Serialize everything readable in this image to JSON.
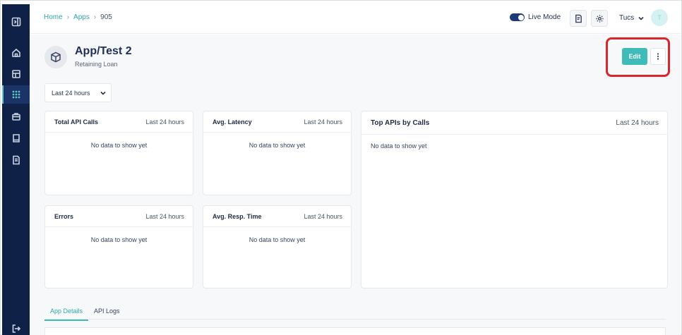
{
  "breadcrumb": {
    "home": "Home",
    "apps": "Apps",
    "current": "905"
  },
  "header": {
    "live_mode_label": "Live Mode",
    "user_name": "Tucs",
    "avatar_initial": "T"
  },
  "app": {
    "title": "App/Test 2",
    "subtitle": "Retaining Loan"
  },
  "actions": {
    "edit_label": "Edit"
  },
  "filter": {
    "time_range": "Last 24 hours"
  },
  "cards": [
    {
      "title": "Total API Calls",
      "range": "Last 24 hours",
      "empty": "No data to show yet"
    },
    {
      "title": "Avg. Latency",
      "range": "Last 24 hours",
      "empty": "No data to show yet"
    },
    {
      "title": "Errors",
      "range": "Last 24 hours",
      "empty": "No data to show yet"
    },
    {
      "title": "Avg. Resp. Time",
      "range": "Last 24 hours",
      "empty": "No data to show yet"
    }
  ],
  "top_apis": {
    "title": "Top APIs by Calls",
    "range": "Last 24 hours",
    "empty": "No data to show yet"
  },
  "tabs": [
    "App Details",
    "API Logs"
  ],
  "colors": {
    "sidebar": "#0f2147",
    "accent": "#3fbcb7",
    "highlight": "#d9252b"
  }
}
